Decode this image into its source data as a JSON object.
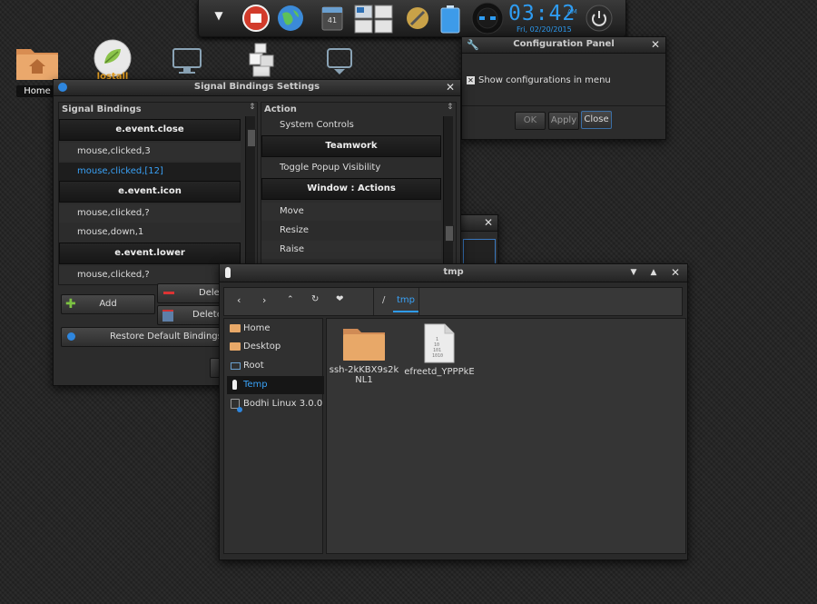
{
  "desktop": {
    "icons": [
      {
        "label": "Home",
        "icon": "home-folder-icon"
      },
      {
        "label": "",
        "icon": "lostall-icon",
        "caption": "lostall"
      },
      {
        "label": "",
        "icon": "monitor-icon"
      },
      {
        "label": "",
        "icon": "boxes-icon"
      },
      {
        "label": "",
        "icon": "drive-icon"
      }
    ]
  },
  "shelf": {
    "time": "03:42",
    "ampm": "AM",
    "date": "Fri, 02/20/2015",
    "calendar_day": "41"
  },
  "config_panel": {
    "title": "Configuration Panel",
    "checkbox_label": "Show configurations in menu",
    "checkbox_checked": true,
    "ok": "OK",
    "apply": "Apply",
    "close": "Close"
  },
  "signal_bindings": {
    "title": "Signal Bindings Settings",
    "left_header": "Signal Bindings",
    "right_header": "Action",
    "bindings": [
      {
        "type": "header",
        "text": "e.event.close"
      },
      {
        "type": "row",
        "text": "mouse,clicked,3",
        "selected": false
      },
      {
        "type": "row",
        "text": "mouse,clicked,[12]",
        "selected": true
      },
      {
        "type": "header",
        "text": "e.event.icon"
      },
      {
        "type": "row",
        "text": "mouse,clicked,?",
        "selected": false
      },
      {
        "type": "row",
        "text": "mouse,down,1",
        "selected": false
      },
      {
        "type": "header",
        "text": "e.event.lower"
      },
      {
        "type": "row",
        "text": "mouse,clicked,?",
        "selected": false
      }
    ],
    "actions": [
      {
        "type": "row",
        "text": "System Controls"
      },
      {
        "type": "header",
        "text": "Teamwork"
      },
      {
        "type": "row",
        "text": "Toggle Popup Visibility"
      },
      {
        "type": "header",
        "text": "Window : Actions"
      },
      {
        "type": "row",
        "text": "Move"
      },
      {
        "type": "row",
        "text": "Resize"
      },
      {
        "type": "row",
        "text": "Raise"
      }
    ],
    "add_button": "Add",
    "delete_button_1": "Dele",
    "delete_button_2": "Delete",
    "restore_button": "Restore Default Bindings"
  },
  "file_manager": {
    "title": "tmp",
    "path_sep": "/",
    "path_segment": "tmp",
    "sidebar": [
      {
        "label": "Home",
        "icon": "home-folder-icon",
        "active": false
      },
      {
        "label": "Desktop",
        "icon": "desktop-folder-icon",
        "active": false
      },
      {
        "label": "Root",
        "icon": "root-drive-icon",
        "active": false
      },
      {
        "label": "Temp",
        "icon": "temp-icon",
        "active": true
      },
      {
        "label": "Bodhi Linux 3.0.0",
        "icon": "disk-icon",
        "active": false
      }
    ],
    "files": [
      {
        "name_line1": "ssh-2kKBX9s2k",
        "name_line2": "NL1",
        "icon": "folder-icon"
      },
      {
        "name_line1": "efreetd_YPPPkE",
        "name_line2": "",
        "icon": "binary-file-icon"
      }
    ]
  },
  "colors": {
    "accent": "#2e9cf2",
    "folder": "#e8a868",
    "selected_text": "#3aa2f7"
  }
}
